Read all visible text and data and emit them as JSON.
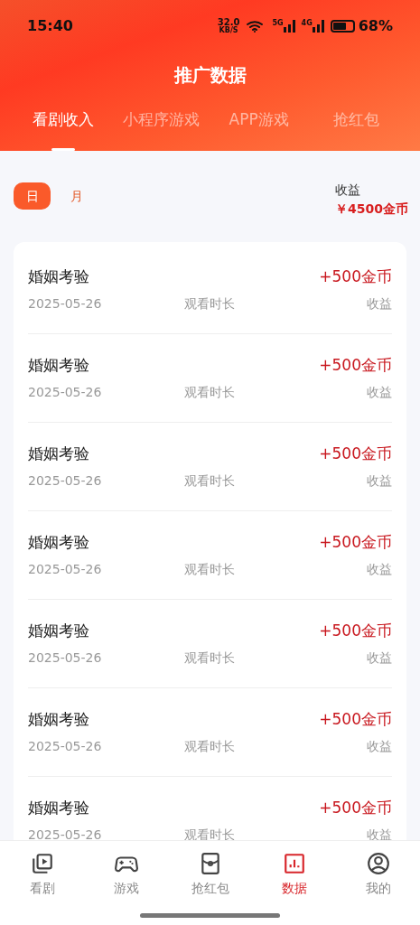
{
  "status_bar": {
    "time": "15:40",
    "speed": "32.0",
    "speed_unit": "KB/S",
    "network_1": "5G",
    "network_2": "4G",
    "battery": "68%"
  },
  "title": "推广数据",
  "tabs": [
    {
      "label": "看剧收入",
      "selected": true
    },
    {
      "label": "小程序游戏",
      "selected": false
    },
    {
      "label": "APP游戏",
      "selected": false
    },
    {
      "label": "抢红包",
      "selected": false
    }
  ],
  "period_toggle": [
    {
      "label": "日",
      "selected": true
    },
    {
      "label": "月",
      "selected": false
    }
  ],
  "summary": {
    "label": "收益",
    "value": "￥4500金币"
  },
  "records": [
    {
      "name": "婚姻考验",
      "amount": "+500金币",
      "date": "2025-05-26",
      "duration_label": "观看时长",
      "earnings_label": "收益"
    },
    {
      "name": "婚姻考验",
      "amount": "+500金币",
      "date": "2025-05-26",
      "duration_label": "观看时长",
      "earnings_label": "收益"
    },
    {
      "name": "婚姻考验",
      "amount": "+500金币",
      "date": "2025-05-26",
      "duration_label": "观看时长",
      "earnings_label": "收益"
    },
    {
      "name": "婚姻考验",
      "amount": "+500金币",
      "date": "2025-05-26",
      "duration_label": "观看时长",
      "earnings_label": "收益"
    },
    {
      "name": "婚姻考验",
      "amount": "+500金币",
      "date": "2025-05-26",
      "duration_label": "观看时长",
      "earnings_label": "收益"
    },
    {
      "name": "婚姻考验",
      "amount": "+500金币",
      "date": "2025-05-26",
      "duration_label": "观看时长",
      "earnings_label": "收益"
    },
    {
      "name": "婚姻考验",
      "amount": "+500金币",
      "date": "2025-05-26",
      "duration_label": "观看时长",
      "earnings_label": "收益"
    }
  ],
  "bottom_nav": [
    {
      "kind": "drama",
      "label": "看剧",
      "selected": false
    },
    {
      "kind": "games",
      "label": "游戏",
      "selected": false
    },
    {
      "kind": "redpacket",
      "label": "抢红包",
      "selected": false
    },
    {
      "kind": "data",
      "label": "数据",
      "selected": true
    },
    {
      "kind": "profile",
      "label": "我的",
      "selected": false
    }
  ]
}
